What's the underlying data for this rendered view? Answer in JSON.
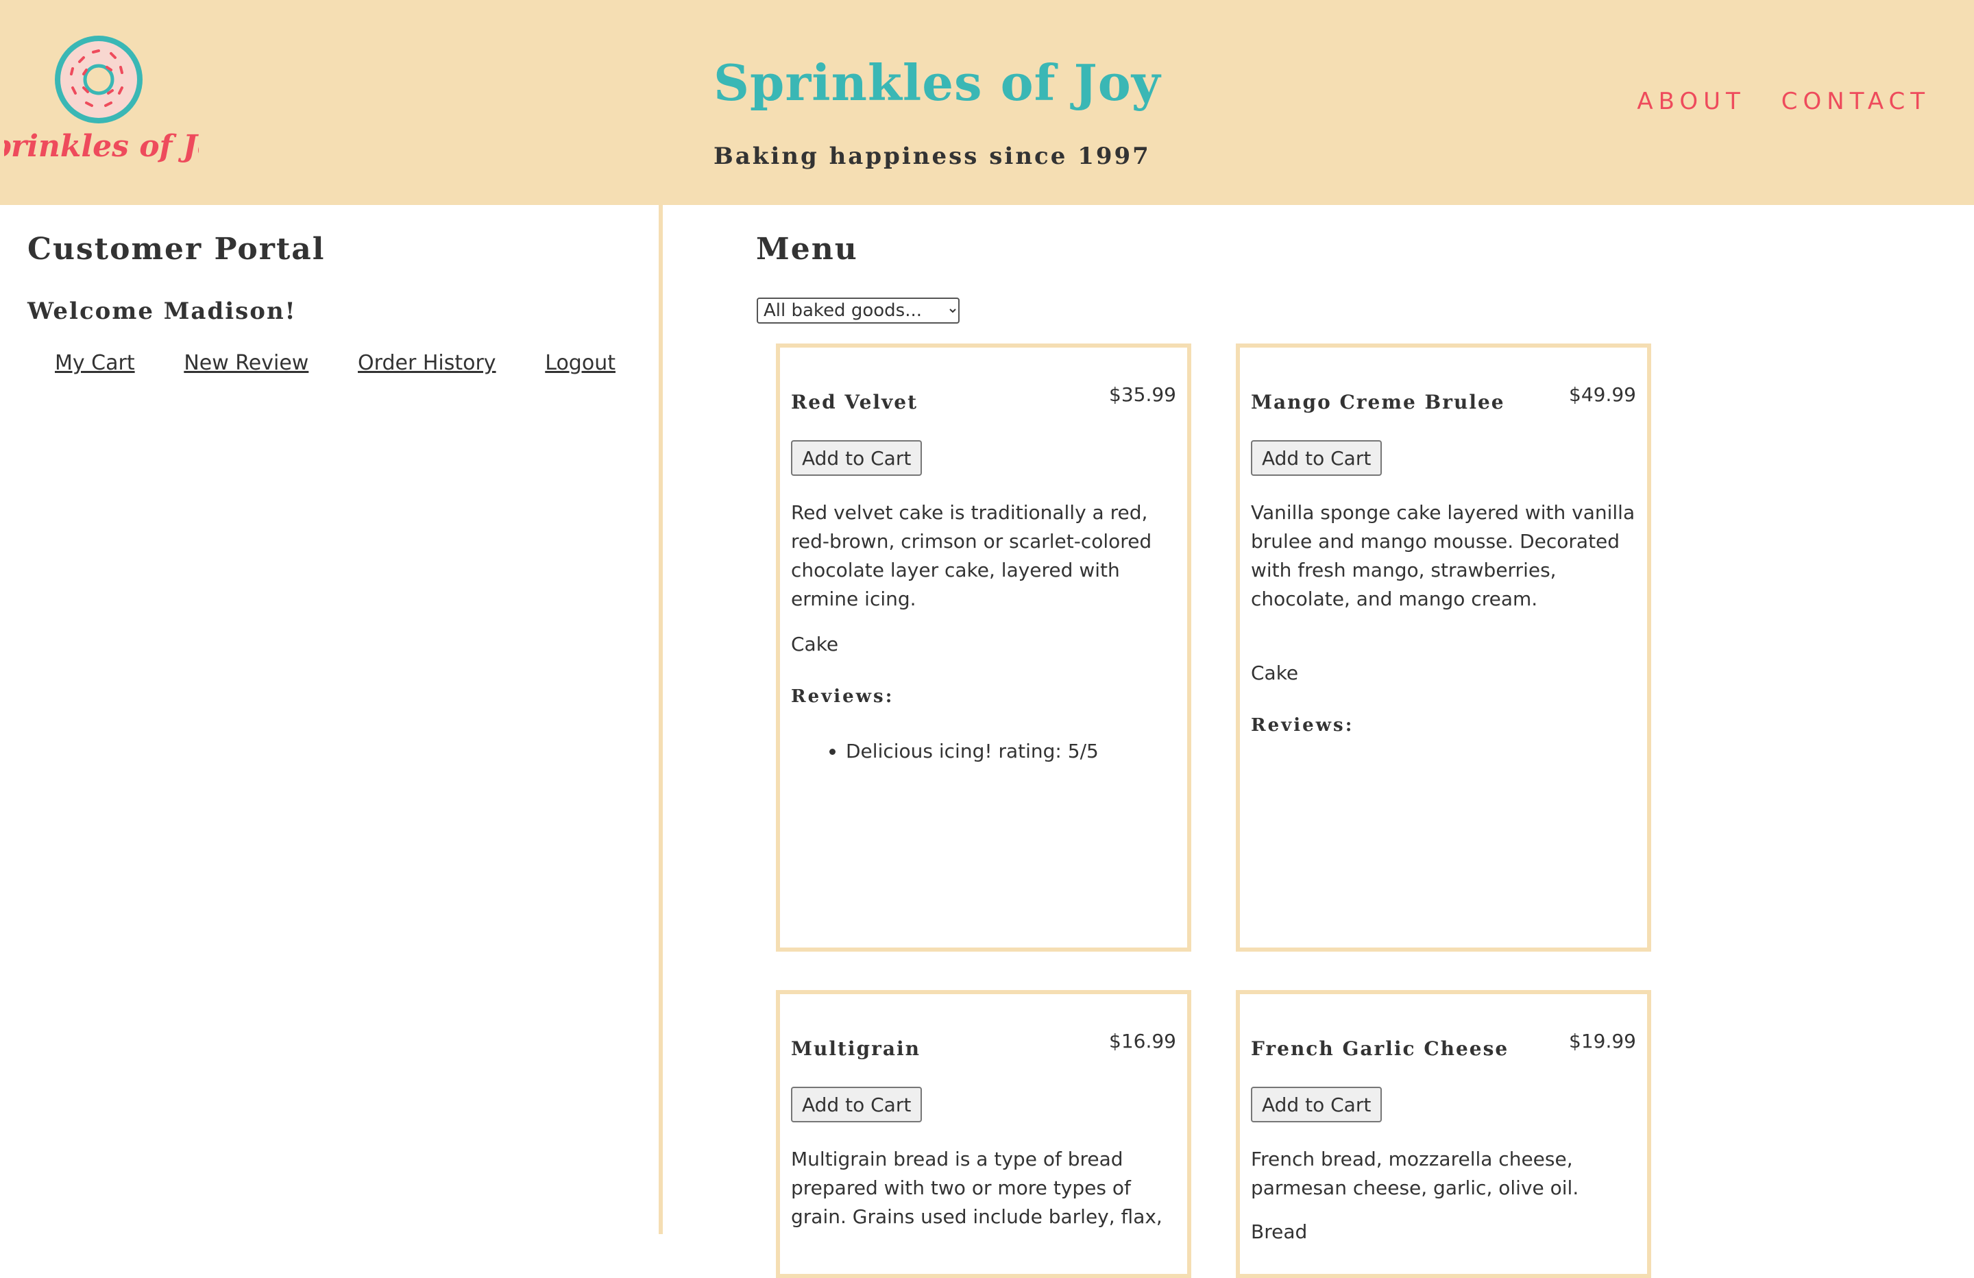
{
  "header": {
    "logo_text": "Sprinkles of Joy",
    "title": "Sprinkles of Joy",
    "tagline": "Baking happiness since 1997",
    "nav": [
      "ABOUT",
      "CONTACT"
    ]
  },
  "colors": {
    "header_bg": "#f5deb3",
    "title_teal": "#3ab7b5",
    "accent_coral": "#ee4b5c",
    "text_dark": "#333333"
  },
  "sidebar": {
    "title": "Customer Portal",
    "welcome": "Welcome Madison!",
    "links": [
      "My Cart",
      "New Review",
      "Order History",
      "Logout"
    ]
  },
  "menu": {
    "title": "Menu",
    "filter_selected": "All baked goods...",
    "add_button_label": "Add to Cart",
    "reviews_label": "Reviews:",
    "items": [
      {
        "name": "Red Velvet",
        "price": "$35.99",
        "description": "Red velvet cake is traditionally a red, red-brown, crimson or scarlet-colored chocolate layer cake, layered with ermine icing.",
        "category": "Cake",
        "reviews": [
          "Delicious icing! rating: 5/5"
        ]
      },
      {
        "name": "Mango Creme Brulee",
        "price": "$49.99",
        "description": "Vanilla sponge cake layered with vanilla brulee and mango mousse. Decorated with fresh mango, strawberries, chocolate, and mango cream.",
        "category": "Cake",
        "reviews": []
      },
      {
        "name": "Multigrain",
        "price": "$16.99",
        "description": "Multigrain bread is a type of bread prepared with two or more types of grain. Grains used include barley, flax,",
        "category": "",
        "reviews": []
      },
      {
        "name": "French Garlic Cheese",
        "price": "$19.99",
        "description": "French bread, mozzarella cheese, parmesan cheese, garlic, olive oil.",
        "category": "Bread",
        "reviews": []
      }
    ]
  }
}
